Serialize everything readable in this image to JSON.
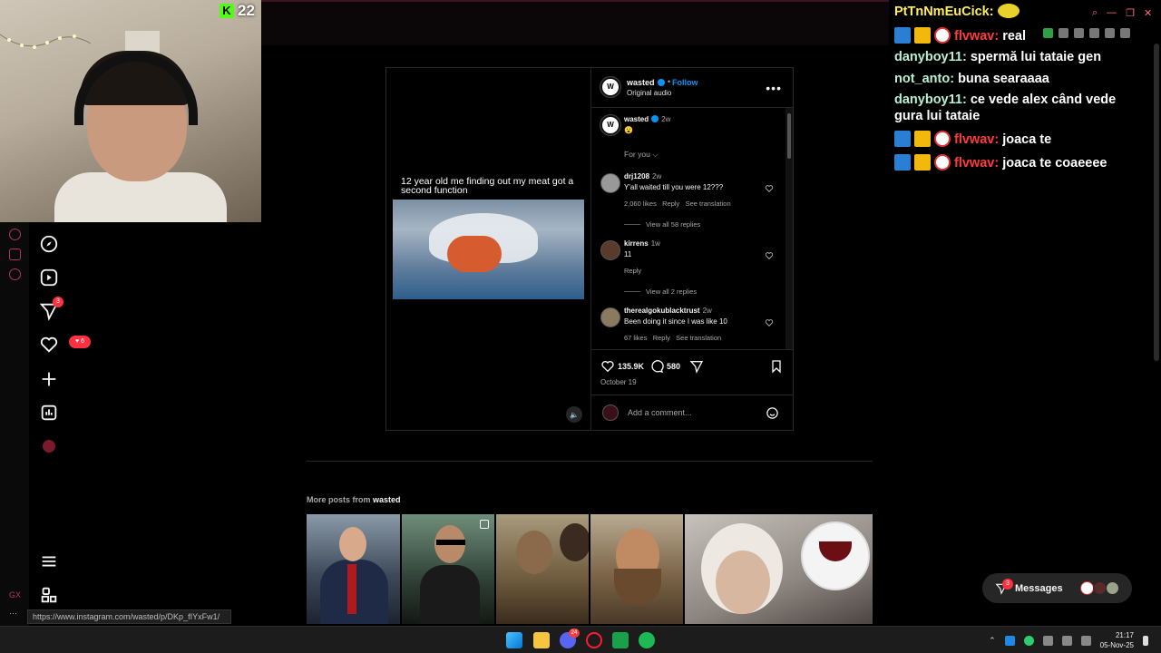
{
  "webcam": {
    "kick_count": "22"
  },
  "sidebar": {
    "notifications_badge": "3",
    "likes_badge": "6",
    "footer_label": "GX"
  },
  "post": {
    "meme_caption": "12 year old me finding out my meat got a second function",
    "author": "wasted",
    "follow_label": "Follow",
    "audio_label": "Original audio",
    "caption_author": "wasted",
    "caption_time": "2w",
    "caption_emoji": "😮",
    "sort_label": "For you",
    "comments": [
      {
        "user": "drj1208",
        "time": "2w",
        "text": "Y'all waited till you were 12???",
        "likes": "2,060 likes",
        "reply": "Reply",
        "translate": "See translation",
        "view_replies": "View all 58 replies"
      },
      {
        "user": "kirrens",
        "time": "1w",
        "text": "11",
        "likes": "",
        "reply": "Reply",
        "translate": "",
        "view_replies": "View all 2 replies"
      },
      {
        "user": "therealgokublacktrust",
        "time": "2w",
        "text": "Been doing it since I was like 10",
        "likes": "67 likes",
        "reply": "Reply",
        "translate": "See translation",
        "view_replies": ""
      }
    ],
    "like_count": "135.9K",
    "comment_count": "580",
    "date": "October 19",
    "add_comment_placeholder": "Add a comment..."
  },
  "more_posts": {
    "prefix": "More posts from",
    "author": "wasted"
  },
  "chat": {
    "header_user": "PtTnNmEuCick:",
    "messages": [
      {
        "user": "flvwav:",
        "text": "real",
        "badges": true,
        "user_color": "red"
      },
      {
        "user": "danyboy11:",
        "text": "spermă lui tataie gen",
        "badges": false,
        "user_color": "green"
      },
      {
        "user": "not_anto:",
        "text": "buna searaaaa",
        "badges": false,
        "user_color": "green"
      },
      {
        "user": "danyboy11:",
        "text": "ce vede alex când vede gura lui tataie",
        "badges": false,
        "user_color": "green"
      },
      {
        "user": "flvwav:",
        "text": "joaca te",
        "badges": true,
        "user_color": "red"
      },
      {
        "user": "flvwav:",
        "text": "joaca te coaeeee",
        "badges": true,
        "user_color": "red"
      }
    ]
  },
  "messages_button": {
    "label": "Messages",
    "badge": "3"
  },
  "status_url": "https://www.instagram.com/wasted/p/DKp_fIYxFw1/",
  "taskbar": {
    "time": "21:17",
    "date": "05-Nov-25",
    "discord_badge": "24"
  },
  "colors": {
    "accent_pink": "#b3345a",
    "ig_blue": "#0095f6",
    "notif_red": "#ff3040",
    "kick_green": "#53fc18"
  }
}
